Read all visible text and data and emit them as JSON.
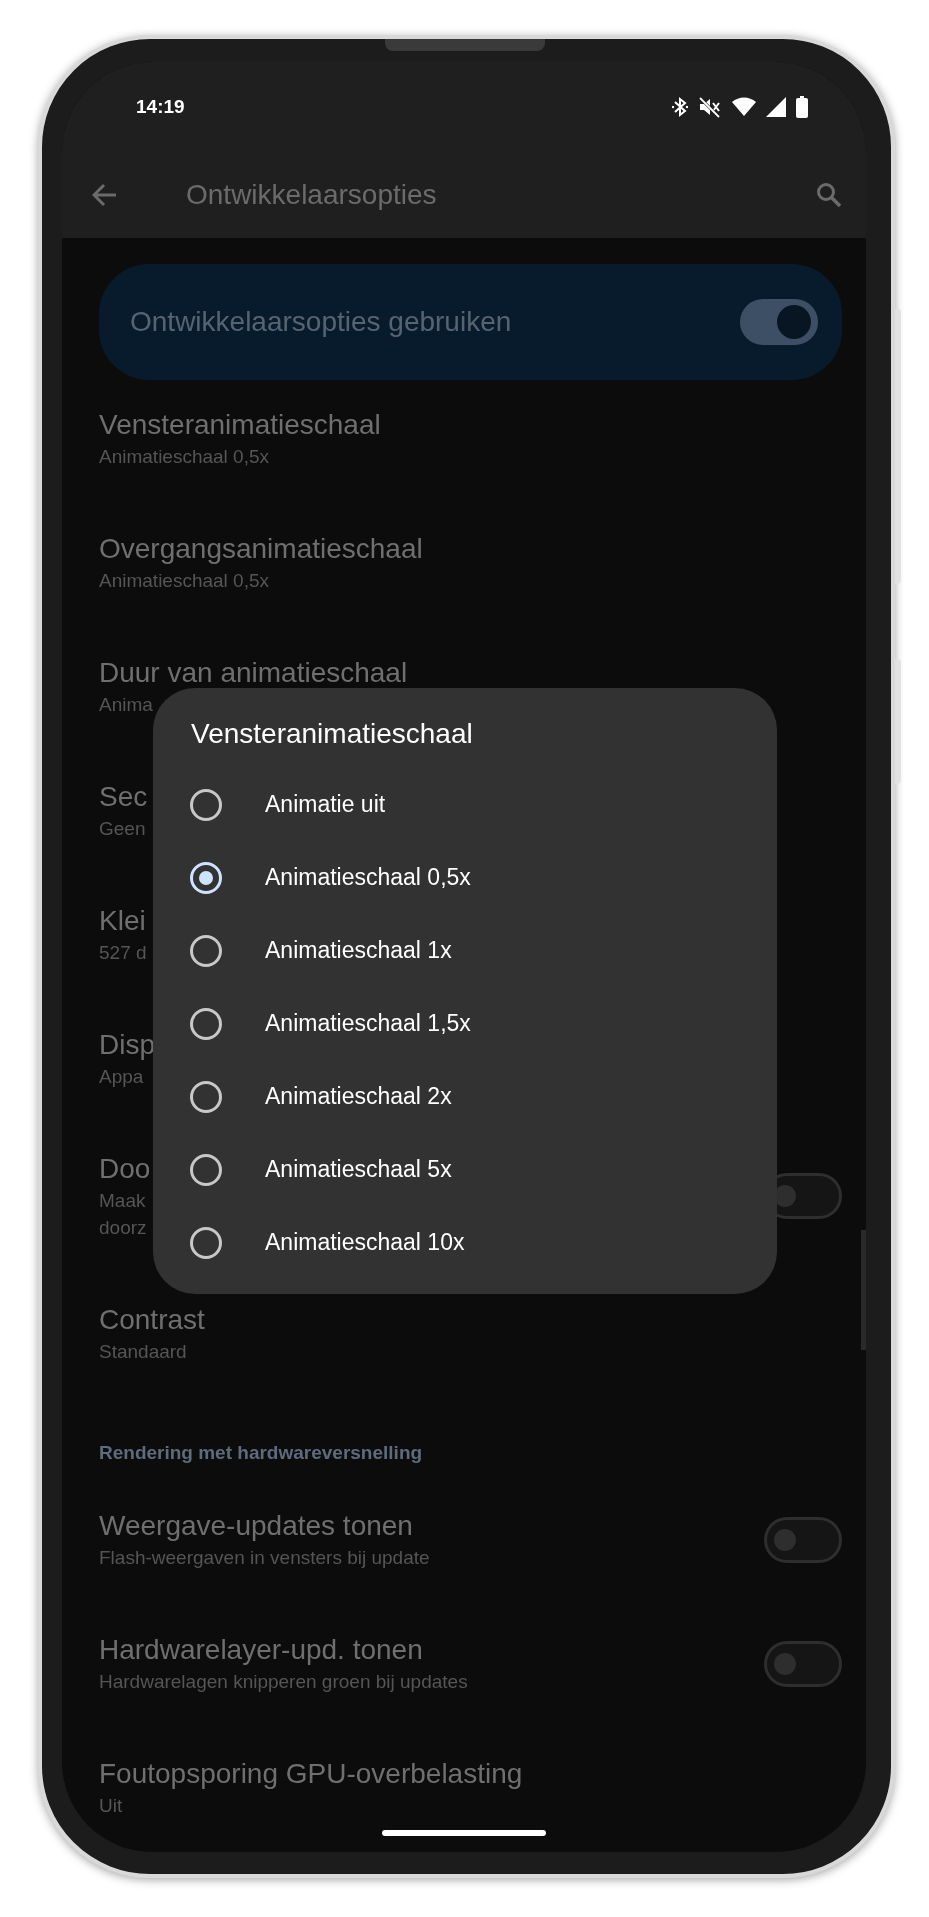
{
  "status_bar": {
    "time": "14:19"
  },
  "app_bar": {
    "title": "Ontwikkelaarsopties"
  },
  "main_switch": {
    "label": "Ontwikkelaarsopties gebruiken",
    "on": true
  },
  "settings": [
    {
      "kind": "item",
      "title": "Vensteranimatieschaal",
      "subtitle": [
        "Animatieschaal 0,5x"
      ]
    },
    {
      "kind": "item",
      "title": "Overgangsanimatieschaal",
      "subtitle": [
        "Animatieschaal 0,5x"
      ]
    },
    {
      "kind": "item",
      "title": "Duur van animatieschaal",
      "subtitle": [
        "Anima"
      ]
    },
    {
      "kind": "item",
      "title": "Sec",
      "subtitle": [
        "Geen"
      ]
    },
    {
      "kind": "item",
      "title": "Klei",
      "subtitle": [
        "527 d"
      ]
    },
    {
      "kind": "item",
      "title": "Disp",
      "subtitle": [
        "Appa"
      ]
    },
    {
      "kind": "toggle",
      "title": "Doo",
      "subtitle": [
        "Maak",
        "doorz"
      ],
      "on": false
    },
    {
      "kind": "item",
      "title": "Contrast",
      "subtitle": [
        "Standaard"
      ]
    },
    {
      "kind": "header",
      "title": "Rendering met hardwareversnelling"
    },
    {
      "kind": "toggle",
      "title": "Weergave-updates tonen",
      "subtitle": [
        "Flash-weergaven in vensters bij update"
      ],
      "on": false
    },
    {
      "kind": "toggle",
      "title": "Hardwarelayer-upd. tonen",
      "subtitle": [
        "Hardwarelagen knipperen groen bij updates"
      ],
      "on": false
    },
    {
      "kind": "item",
      "title": "Foutopsporing GPU-overbelasting",
      "subtitle": [
        "Uit"
      ]
    }
  ],
  "dialog": {
    "title": "Vensteranimatieschaal",
    "options": [
      {
        "label": "Animatie uit",
        "selected": false
      },
      {
        "label": "Animatieschaal 0,5x",
        "selected": true
      },
      {
        "label": "Animatieschaal 1x",
        "selected": false
      },
      {
        "label": "Animatieschaal 1,5x",
        "selected": false
      },
      {
        "label": "Animatieschaal 2x",
        "selected": false
      },
      {
        "label": "Animatieschaal 5x",
        "selected": false
      },
      {
        "label": "Animatieschaal 10x",
        "selected": false
      }
    ]
  }
}
